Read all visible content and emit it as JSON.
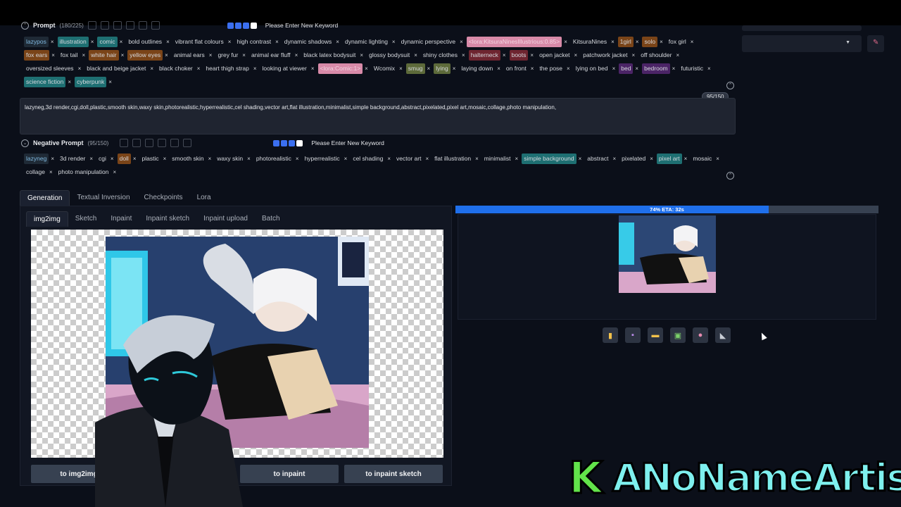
{
  "prompt": {
    "title": "Prompt",
    "count": "(180/225)",
    "keyword_placeholder": "Please Enter New Keyword",
    "tags": [
      {
        "label": "lazypos",
        "bg": "#1f2a36",
        "color": "#7fb8e0"
      },
      {
        "label": "illustration",
        "bg": "#1e6f72"
      },
      {
        "label": "comic",
        "bg": "#1e6f72"
      },
      {
        "label": "bold outlines"
      },
      {
        "label": "vibrant flat colours"
      },
      {
        "label": "high contrast"
      },
      {
        "label": "dynamic shadows"
      },
      {
        "label": "dynamic lighting"
      },
      {
        "label": "dynamic perspective"
      },
      {
        "label": "<lora:KitsuraNinesIllustrious:0.85>",
        "bg": "#d88aa8",
        "color": "#f3d6e2"
      },
      {
        "label": "KitsuraNines"
      },
      {
        "label": "1girl",
        "bg": "#7a4418"
      },
      {
        "label": "solo",
        "bg": "#7a4418"
      },
      {
        "label": "fox girl"
      },
      {
        "label": "fox ears",
        "bg": "#7a4418"
      },
      {
        "label": "fox tail"
      },
      {
        "label": "white hair",
        "bg": "#7a4418"
      },
      {
        "label": "yellow eyes",
        "bg": "#7a4418"
      },
      {
        "label": "animal ears"
      },
      {
        "label": "grey fur"
      },
      {
        "label": "animal ear fluff"
      },
      {
        "label": "black latex bodysuit"
      },
      {
        "label": "glossy bodysuit"
      },
      {
        "label": "shiny clothes"
      },
      {
        "label": "halterneck",
        "bg": "#6e2530"
      },
      {
        "label": "boots",
        "bg": "#6e2530"
      },
      {
        "label": "open jacket"
      },
      {
        "label": "patchwork jacket"
      },
      {
        "label": "off shoulder"
      },
      {
        "label": "oversized sleeves"
      },
      {
        "label": "black and beige jacket"
      },
      {
        "label": "black choker"
      },
      {
        "label": "heart thigh strap"
      },
      {
        "label": "looking at viewer"
      },
      {
        "label": "<lora:Comic:1>",
        "bg": "#d88aa8",
        "color": "#f3d6e2"
      },
      {
        "label": "Wcomix"
      },
      {
        "label": "smug",
        "bg": "#5d6a3a"
      },
      {
        "label": "lying",
        "bg": "#5d6a3a"
      },
      {
        "label": "laying down"
      },
      {
        "label": "on front"
      },
      {
        "label": "the pose"
      },
      {
        "label": "lying on bed"
      },
      {
        "label": "bed",
        "bg": "#4b2466"
      },
      {
        "label": "bedroom",
        "bg": "#4b2466"
      },
      {
        "label": "futuristic"
      },
      {
        "label": "science fiction",
        "bg": "#1e6f72"
      },
      {
        "label": "cyberpunk",
        "bg": "#1e6f72"
      }
    ]
  },
  "negative_text": "lazyneg,3d render,cgi,doll,plastic,smooth skin,waxy skin,photorealistic,hyperrealistic,cel shading,vector art,flat illustration,minimalist,simple background,abstract,pixelated,pixel art,mosaic,collage,photo manipulation,",
  "negative_counter": "95/150",
  "negative": {
    "title": "Negative Prompt",
    "count": "(95/150)",
    "keyword_placeholder": "Please Enter New Keyword",
    "tags": [
      {
        "label": "lazyneg",
        "bg": "#1f2a36",
        "color": "#7fb8e0"
      },
      {
        "label": "3d render"
      },
      {
        "label": "cgi"
      },
      {
        "label": "doll",
        "bg": "#7a4418"
      },
      {
        "label": "plastic"
      },
      {
        "label": "smooth skin"
      },
      {
        "label": "waxy skin"
      },
      {
        "label": "photorealistic"
      },
      {
        "label": "hyperrealistic"
      },
      {
        "label": "cel shading"
      },
      {
        "label": "vector art"
      },
      {
        "label": "flat illustration"
      },
      {
        "label": "minimalist"
      },
      {
        "label": "simple background",
        "bg": "#1e6f72"
      },
      {
        "label": "abstract"
      },
      {
        "label": "pixelated"
      },
      {
        "label": "pixel art",
        "bg": "#1e6f72"
      },
      {
        "label": "mosaic"
      },
      {
        "label": "collage"
      },
      {
        "label": "photo manipulation"
      }
    ]
  },
  "main_tabs": [
    "Generation",
    "Textual Inversion",
    "Checkpoints",
    "Lora"
  ],
  "sub_tabs": [
    "img2img",
    "Sketch",
    "Inpaint",
    "Inpaint sketch",
    "Inpaint upload",
    "Batch"
  ],
  "progress": {
    "label": "74% ETA: 32s",
    "percent": 74
  },
  "buttons": {
    "to_img2img": "to img2img",
    "to_inpaint": "to inpaint",
    "to_inpaint_sketch": "to inpaint sketch"
  },
  "toolbar_icons": [
    "folder-icon",
    "save-icon",
    "zip-icon",
    "image-icon",
    "palette-icon",
    "ruler-icon"
  ],
  "brand": {
    "k": "K",
    "name": "ANoNameArtist",
    "k_color": "#62e34a",
    "name_color": "#7ef0ee"
  },
  "colors": {
    "accent": "#1f6feb",
    "bg": "#0b0f19"
  }
}
